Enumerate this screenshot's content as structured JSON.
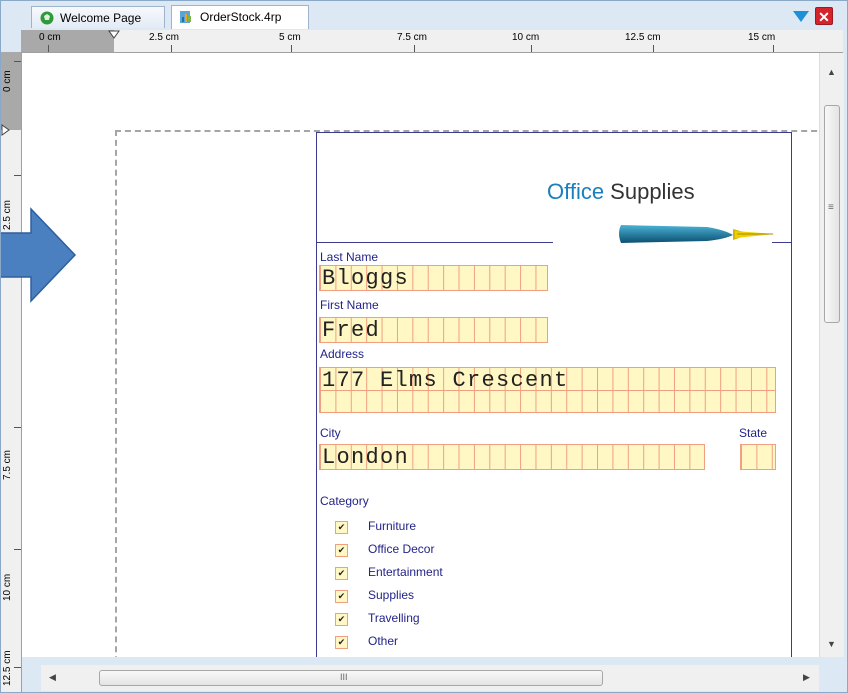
{
  "tabs": [
    {
      "label": "Welcome Page",
      "icon": "welcome-globe-icon"
    },
    {
      "label": "OrderStock.4rp",
      "icon": "report-chart-icon"
    }
  ],
  "window_controls": {
    "menu_icon": "dropdown-triangle-icon",
    "close_icon": "close-icon",
    "close_symbol": "✕"
  },
  "ruler": {
    "horizontal": [
      "0 cm",
      "2.5 cm",
      "5 cm",
      "7.5 cm",
      "10 cm",
      "12.5 cm",
      "15 cm"
    ],
    "vertical": [
      "0 cm",
      "2.5 cm",
      "7.5 cm",
      "10 cm",
      "12.5 cm"
    ]
  },
  "scrollbar": {
    "grip": "≡",
    "h_grip": "III",
    "up": "▲",
    "down": "▼",
    "left": "◀",
    "right": "▶"
  },
  "logo": {
    "word1": "Office",
    "word2": " Supplies",
    "pen_icon": "fountain-pen-icon"
  },
  "fields": {
    "last_name": {
      "label": "Last Name",
      "value": "Bloggs"
    },
    "first_name": {
      "label": "First Name",
      "value": "Fred"
    },
    "address": {
      "label": "Address",
      "value": "177 Elms Crescent"
    },
    "city": {
      "label": "City",
      "value": "London"
    },
    "state": {
      "label": "State",
      "value": ""
    }
  },
  "category": {
    "label": "Category",
    "check_mark": "✔",
    "items": [
      "Furniture",
      "Office Decor",
      "Entertainment",
      "Supplies",
      "Travelling",
      "Other"
    ]
  },
  "colors": {
    "form_blue": "#23238a",
    "box_fill": "#fff7c4",
    "box_border": "#f0a080",
    "arrow_blue": "#4a7fc0",
    "brand_blue": "#1a7fbf"
  }
}
